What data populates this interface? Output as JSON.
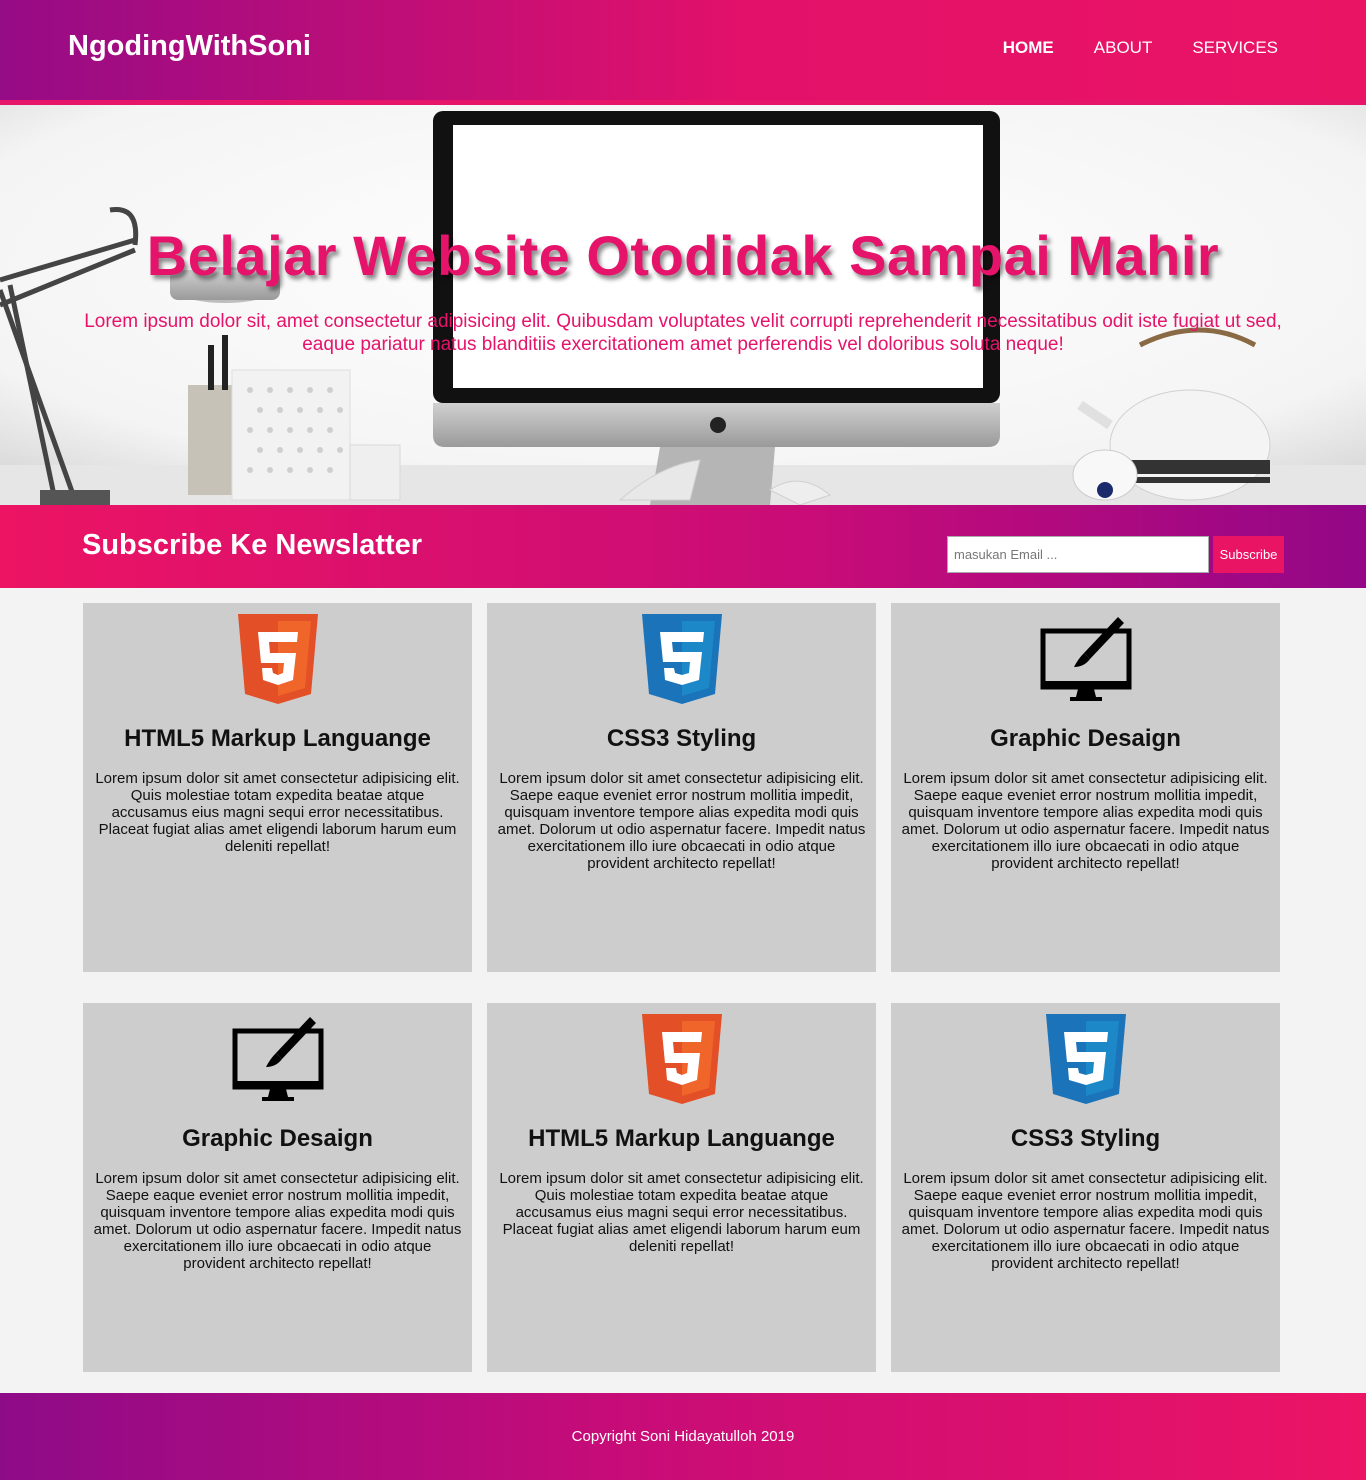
{
  "header": {
    "brand": "NgodingWithSoni",
    "nav": [
      "HOME",
      "ABOUT",
      "SERVICES"
    ]
  },
  "hero": {
    "title": "Belajar Website Otodidak Sampai Mahir",
    "text": "Lorem ipsum dolor sit, amet consectetur adipisicing elit. Quibusdam voluptates velit corrupti reprehenderit necessitatibus odit iste fugiat ut sed, eaque pariatur natus blanditiis exercitationem amet perferendis vel doloribus soluta neque!"
  },
  "newsletter": {
    "title": "Subscribe Ke Newslatter",
    "placeholder": "masukan Email ...",
    "button": "Subscribe"
  },
  "cards": [
    {
      "icon": "html5-icon",
      "title": "HTML5 Markup Languange",
      "text": "Lorem ipsum dolor sit amet consectetur adipisicing elit. Quis molestiae totam expedita beatae atque accusamus eius magni sequi error necessitatibus. Placeat fugiat alias amet eligendi laborum harum eum deleniti repellat!"
    },
    {
      "icon": "css3-icon",
      "title": "CSS3 Styling",
      "text": "Lorem ipsum dolor sit amet consectetur adipisicing elit. Saepe eaque eveniet error nostrum mollitia impedit, quisquam inventore tempore alias expedita modi quis amet. Dolorum ut odio aspernatur facere. Impedit natus exercitationem illo iure obcaecati in odio atque provident architecto repellat!"
    },
    {
      "icon": "graphic-design-monitor-icon",
      "title": "Graphic Desaign",
      "text": "Lorem ipsum dolor sit amet consectetur adipisicing elit. Saepe eaque eveniet error nostrum mollitia impedit, quisquam inventore tempore alias expedita modi quis amet. Dolorum ut odio aspernatur facere. Impedit natus exercitationem illo iure obcaecati in odio atque provident architecto repellat!"
    },
    {
      "icon": "graphic-design-monitor-icon",
      "title": "Graphic Desaign",
      "text": "Lorem ipsum dolor sit amet consectetur adipisicing elit. Saepe eaque eveniet error nostrum mollitia impedit, quisquam inventore tempore alias expedita modi quis amet. Dolorum ut odio aspernatur facere. Impedit natus exercitationem illo iure obcaecati in odio atque provident architecto repellat!"
    },
    {
      "icon": "html5-icon",
      "title": "HTML5 Markup Languange",
      "text": "Lorem ipsum dolor sit amet consectetur adipisicing elit. Quis molestiae totam expedita beatae atque accusamus eius magni sequi error necessitatibus. Placeat fugiat alias amet eligendi laborum harum eum deleniti repellat!"
    },
    {
      "icon": "css3-icon",
      "title": "CSS3 Styling",
      "text": "Lorem ipsum dolor sit amet consectetur adipisicing elit. Saepe eaque eveniet error nostrum mollitia impedit, quisquam inventore tempore alias expedita modi quis amet. Dolorum ut odio aspernatur facere. Impedit natus exercitationem illo iure obcaecati in odio atque provident architecto repellat!"
    }
  ],
  "footer": {
    "copyright": "Copyright Soni Hidayatulloh 2019"
  },
  "colors": {
    "accent": "#e6136b",
    "purple": "#960b86",
    "card_bg": "#cdcdcd",
    "page_bg": "#f3f3f3"
  }
}
